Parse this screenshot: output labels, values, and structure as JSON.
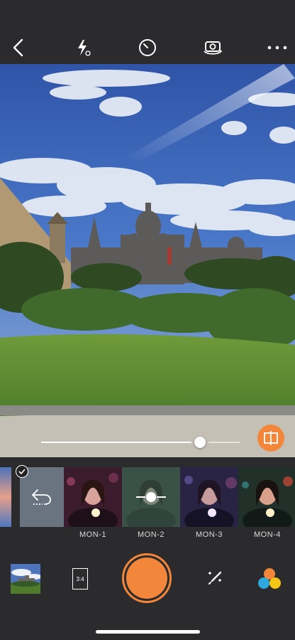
{
  "top_bar": {
    "icons": [
      "back-arrow-icon",
      "flash-auto-icon",
      "timer-icon",
      "switch-camera-icon",
      "more-icon"
    ]
  },
  "viewfinder": {
    "exposure_slider_level": 0.8
  },
  "filters": {
    "selected": "none",
    "items": [
      {
        "label": "MON-1"
      },
      {
        "label": "MON-2"
      },
      {
        "label": "MON-3"
      },
      {
        "label": "MON-4"
      }
    ]
  },
  "bottom_bar": {
    "aspect_ratio_label": "3:4",
    "icons": [
      "gallery-thumbnail",
      "aspect-ratio-icon",
      "shutter-button",
      "magic-wand-icon",
      "color-filters-icon"
    ]
  },
  "colors": {
    "accent": "#f2863a",
    "background": "#2b2b2d"
  }
}
